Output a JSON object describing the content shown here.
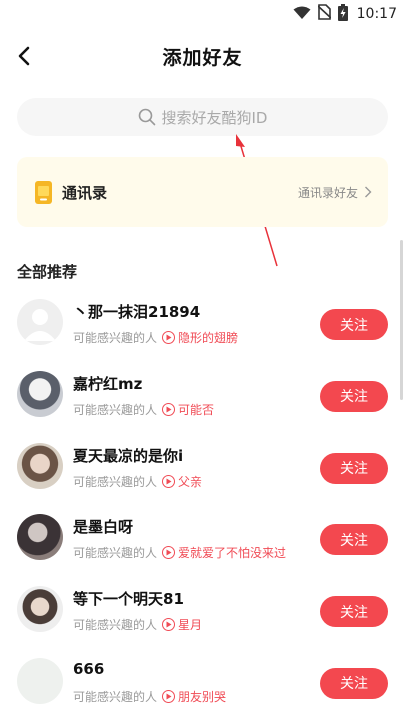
{
  "status_bar": {
    "time": "10:17"
  },
  "header": {
    "title": "添加好友"
  },
  "search": {
    "placeholder": "搜索好友酷狗ID"
  },
  "contacts": {
    "label": "通讯录",
    "link_text": "通讯录好友"
  },
  "section": {
    "title": "全部推荐"
  },
  "colors": {
    "accent": "#f3484f",
    "contacts_bg": "#fffbeb",
    "search_bg": "#f6f6f6"
  },
  "users": [
    {
      "name": "丶那一抹泪21894",
      "reason": "可能感兴趣的人",
      "song": "隐形的翅膀",
      "follow_label": "关注",
      "avatar": "default-avatar"
    },
    {
      "name": "嘉柠红mz",
      "reason": "可能感兴趣的人",
      "song": "可能否",
      "follow_label": "关注",
      "avatar": "photo-avatar"
    },
    {
      "name": "夏天最凉的是你i",
      "reason": "可能感兴趣的人",
      "song": "父亲",
      "follow_label": "关注",
      "avatar": "photo-avatar"
    },
    {
      "name": "是墨白呀",
      "reason": "可能感兴趣的人",
      "song": "爱就爱了不怕没来过",
      "follow_label": "关注",
      "avatar": "photo-avatar"
    },
    {
      "name": "等下一个明天81",
      "reason": "可能感兴趣的人",
      "song": "星月",
      "follow_label": "关注",
      "avatar": "photo-avatar"
    },
    {
      "name": "666",
      "reason": "可能感兴趣的人",
      "song": "朋友别哭",
      "follow_label": "关注",
      "avatar": "blank-avatar"
    }
  ]
}
